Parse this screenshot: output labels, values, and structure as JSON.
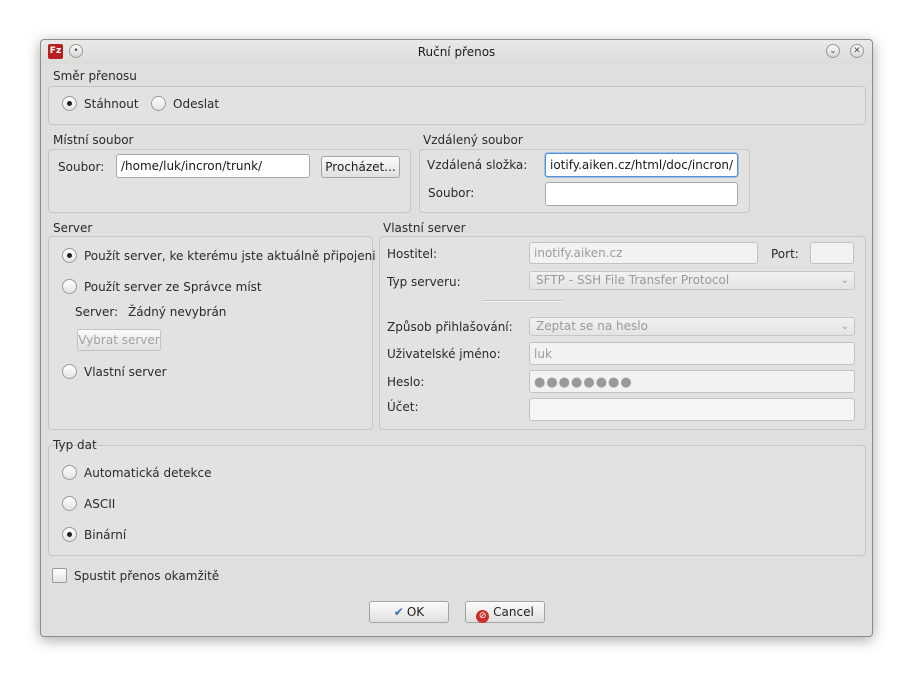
{
  "window": {
    "title": "Ruční přenos"
  },
  "direction": {
    "label": "Směr přenosu",
    "download": "Stáhnout",
    "upload": "Odeslat",
    "selected": "download"
  },
  "local_file": {
    "label": "Místní soubor",
    "file_label": "Soubor:",
    "file_value": "/home/luk/incron/trunk/",
    "browse_label": "Procházet..."
  },
  "remote_file": {
    "label": "Vzdálený soubor",
    "folder_label": "Vzdálená složka:",
    "folder_value": "iotify.aiken.cz/html/doc/incron/",
    "file_label": "Soubor:",
    "file_value": ""
  },
  "server": {
    "label": "Server",
    "option_current": "Použít server, ke kterému jste aktuálně připojeni",
    "option_manager": "Použít server ze Správce míst",
    "server_info_label": "Server:",
    "server_info_value": "Žádný nevybrán",
    "select_server_label": "Vybrat server",
    "option_custom": "Vlastní server",
    "selected": "current"
  },
  "custom_server": {
    "label": "Vlastní server",
    "host_label": "Hostitel:",
    "host_value": "inotify.aiken.cz",
    "port_label": "Port:",
    "port_value": "",
    "type_label": "Typ serveru:",
    "type_value": "SFTP - SSH File Transfer Protocol",
    "logon_label": "Způsob přihlašování:",
    "logon_value": "Zeptat se na heslo",
    "user_label": "Uživatelské jméno:",
    "user_value": "luk",
    "password_label": "Heslo:",
    "password_value": "●●●●●●●●",
    "account_label": "Účet:",
    "account_value": ""
  },
  "data_type": {
    "label": "Typ dat",
    "auto": "Automatická detekce",
    "ascii": "ASCII",
    "binary": "Binární",
    "selected": "binary"
  },
  "start_immediately": {
    "label": "Spustit přenos okamžitě",
    "checked": false
  },
  "buttons": {
    "ok": "OK",
    "cancel": "Cancel"
  }
}
